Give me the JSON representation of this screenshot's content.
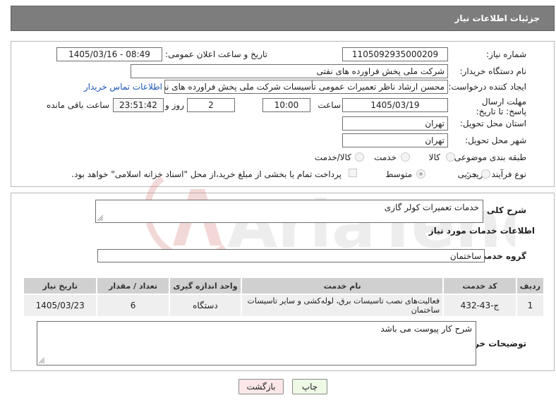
{
  "header": {
    "title": "جزئیات اطلاعات نیاز"
  },
  "labels": {
    "need_number": "شماره نیاز:",
    "announce_datetime": "تاریخ و ساعت اعلان عمومی:",
    "buyer_org": "نام دستگاه خریدار:",
    "requester": "ایجاد کننده درخواست:",
    "buyer_contact": "اطلاعات تماس خریدار",
    "deadline": "مهلت ارسال پاسخ: تا تاریخ:",
    "hour": "ساعت",
    "day_and": "روز و",
    "remaining": "ساعت باقی مانده",
    "delivery_province": "استان محل تحویل:",
    "delivery_city": "شهر محل تحویل:",
    "category": "طبقه بندی موضوعی:",
    "purchase_type": "نوع فرآیند خرید :",
    "general_desc": "شرح کلی نیاز:",
    "services_info": "اطلاعات خدمات مورد نیاز",
    "service_group": "گروه خدمت:",
    "buyer_notes": "توضیحات خریدار:"
  },
  "values": {
    "need_number": "1105092935000209",
    "announce_datetime": "1405/03/16 - 08:49",
    "buyer_org": "شرکت ملی پخش فراورده های نفتی",
    "requester": "محسن ارشاد ناظر تعمیرات عمومی تأسیسات شرکت ملی پخش فراورده های نفتی",
    "deadline_date": "1405/03/19",
    "deadline_time": "10:00",
    "days": "2",
    "remaining_time": "23:51:42",
    "province": "تهران",
    "city": "تهران",
    "general_desc": "خدمات تعمیرات کولر گازی",
    "service_group": "ساختمان",
    "buyer_notes": "شرح کار پیوست می باشد"
  },
  "category_options": [
    {
      "label": "کالا",
      "selected": false
    },
    {
      "label": "خدمت",
      "selected": false
    },
    {
      "label": "کالا/خدمت",
      "selected": false
    }
  ],
  "purchase_options": [
    {
      "label": "جزیی",
      "selected": false
    },
    {
      "label": "متوسط",
      "selected": true
    }
  ],
  "payment_note": "پرداخت تمام یا بخشی از مبلغ خرید،از محل \"اسناد خزانه اسلامی\" خواهد بود.",
  "table": {
    "headers": [
      "ردیف",
      "کد خدمت",
      "نام خدمت",
      "واحد اندازه گیری",
      "تعداد / مقدار",
      "تاریخ نیاز"
    ],
    "rows": [
      [
        "1",
        "ج-43-432",
        "فعالیت‌های نصب تاسیسات برق، لوله‌کشی و سایر تاسیسات ساختمان",
        "دستگاه",
        "6",
        "1405/03/23"
      ]
    ]
  },
  "buttons": {
    "print": "چاپ",
    "back": "بازگشت"
  },
  "watermark": {
    "text": "AriaTender.neT"
  },
  "colors": {
    "header_bg": "#7d7d7d",
    "link": "#1a57b5",
    "print_btn": "#eef9e6",
    "back_btn": "#fbe7e7"
  }
}
